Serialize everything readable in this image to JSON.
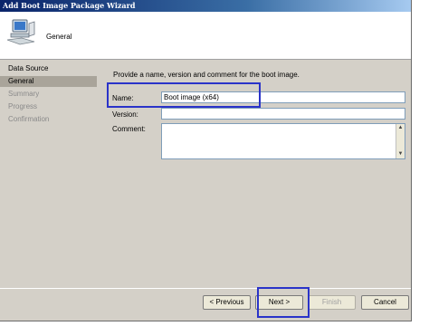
{
  "window": {
    "title": "Add Boot Image Package Wizard"
  },
  "header": {
    "title": "General",
    "icon": "computer-wizard-icon"
  },
  "nav": {
    "items": [
      {
        "label": "Data Source",
        "state": "normal"
      },
      {
        "label": "General",
        "state": "active"
      },
      {
        "label": "Summary",
        "state": "disabled"
      },
      {
        "label": "Progress",
        "state": "disabled"
      },
      {
        "label": "Confirmation",
        "state": "disabled"
      }
    ]
  },
  "form": {
    "instruction": "Provide a name, version and comment for the boot image.",
    "name_label": "Name:",
    "name_value": "Boot image (x64)",
    "version_label": "Version:",
    "version_value": "",
    "comment_label": "Comment:",
    "comment_value": ""
  },
  "buttons": {
    "previous": "< Previous",
    "next": "Next >",
    "finish": "Finish",
    "cancel": "Cancel"
  },
  "colors": {
    "highlight": "#2a33c9",
    "titlebar": "#0a246a",
    "active_nav": "#a9a49a"
  }
}
